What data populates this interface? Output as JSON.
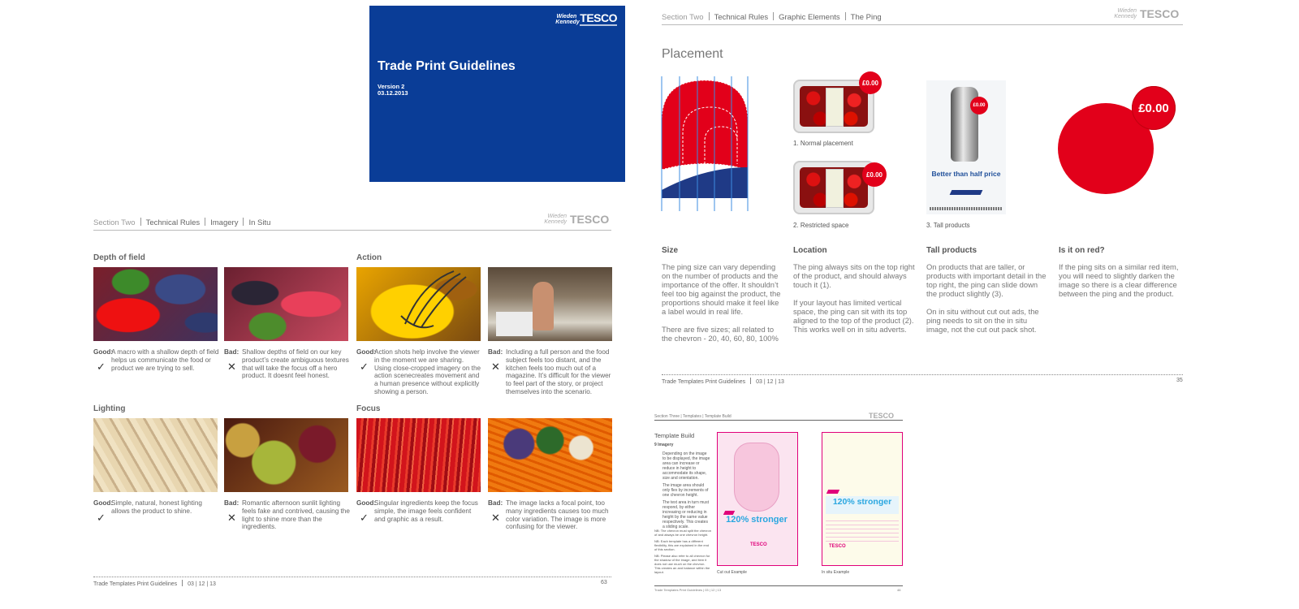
{
  "cover": {
    "logo_wk": "Wieden Kennedy",
    "logo_tesco": "TESCO",
    "title": "Trade Print Guidelines",
    "version": "Version 2",
    "date": "03.12.2013"
  },
  "imagery_page": {
    "breadcrumb": [
      "Section Two",
      "Technical Rules",
      "Imagery",
      "In Situ"
    ],
    "logo_wk": "Wieden Kennedy",
    "logo_tesco": "TESCO",
    "sections": {
      "depth": "Depth of field",
      "action": "Action",
      "lighting": "Lighting",
      "focus": "Focus"
    },
    "captions": [
      {
        "label": "Good:",
        "text": "A macro with a shallow depth of field helps us communicate the food or product we are trying to sell.",
        "mark": "✓"
      },
      {
        "label": "Bad:",
        "text": "Shallow depths of field on our key product’s create ambiguous textures that will take the focus off a hero product. It doesnt feel honest.",
        "mark": "✕"
      },
      {
        "label": "Good:",
        "text": "Action shots help involve the viewer in the moment we are sharing. Using close-cropped imagery on the action scenecreates movement and a human presence without explicitly showing a person.",
        "mark": "✓"
      },
      {
        "label": "Bad:",
        "text": "Including a full person and the food subject feels too distant, and the kitchen feels too much out of a magazine. It’s difficult for the viewer to feel part of the story, or project themselves into the scenario.",
        "mark": "✕"
      },
      {
        "label": "Good:",
        "text": "Simple, natural, honest lighting allows the product to shine.",
        "mark": "✓"
      },
      {
        "label": "Bad:",
        "text": "Romantic afternoon sunlit lighting feels fake and contrived, causing the light to shine more than the ingredients.",
        "mark": "✕"
      },
      {
        "label": "Good:",
        "text": "Singular ingredients keep the focus simple, the image feels confident and graphic as a result.",
        "mark": "✓"
      },
      {
        "label": "Bad:",
        "text": "The image lacks a focal point, too many ingredients causes too much color variation. The image is more confusing for the viewer.",
        "mark": "✕"
      }
    ],
    "footer_left": "Trade Templates Print Guidelines",
    "footer_date": "03 | 12 | 13",
    "footer_page": "63"
  },
  "ping_page": {
    "breadcrumb": [
      "Section Two",
      "Technical Rules",
      "Graphic Elements",
      "The Ping"
    ],
    "logo_wk": "Wieden Kennedy",
    "logo_tesco": "TESCO",
    "heading": "Placement",
    "price_small": "£0.00",
    "price_mid": "£0.00",
    "price_tall": "£0.00",
    "price_big": "£0.00",
    "caption_normal": "1. Normal placement",
    "caption_restricted": "2. Restricted space",
    "caption_tall": "3. Tall products",
    "tall_product_text": "Better than half price",
    "columns": [
      {
        "head": "Size",
        "paras": [
          "The ping size can vary depending on the number of products and the importance of the offer. It shouldn’t feel too big against the product, the proportions should make it feel like a label would in real life.",
          "There are five sizes; all related to the chevron - 20, 40, 60, 80, 100%"
        ]
      },
      {
        "head": "Location",
        "paras": [
          "The ping always sits on the top right of the product, and should always touch it (1).",
          "If your layout has limited vertical space, the ping can sit with its top aligned to the top of the product (2). This works well on in situ adverts."
        ]
      },
      {
        "head": "Tall products",
        "paras": [
          "On products that are taller, or products with important detail in the top right, the ping can slide down the product slightly (3).",
          "On in situ without cut out ads, the ping needs to sit on the in situ image, not the cut out pack shot."
        ]
      },
      {
        "head": "Is it on red?",
        "paras": [
          "If the ping sits on a similar red item, you will need to slightly darken the image so there is a clear difference between the ping and the product."
        ]
      }
    ],
    "footer_left": "Trade Templates Print Guidelines",
    "footer_date": "03 | 12 | 13",
    "footer_page": "35"
  },
  "template_page": {
    "breadcrumb": [
      "Section Three",
      "Templates",
      "Template Build"
    ],
    "heading": "Template Build",
    "subhead": "9   Imagery",
    "paras": [
      "Depending on the image to be displayed, the image area can increase or reduce in height to accommodate its shape, size and orientation.",
      "The image area should only flex by increments of one chevron height.",
      "The text area in turn must respond, by either increasing or reducing in height by the same value respectively. This creates a sliding scale."
    ],
    "notes": [
      "NB: The chevron must split the chevron of and always be one chevron height.",
      "NB: Each template has a different flexibility, this are explained in the end of this section.",
      "NB: Please also refer to all chevron for the shadow of the image, and item it does not use much on the chevron. This creates an and balance within the layout."
    ],
    "headline_text": "120% stronger",
    "caption_left": "Cut out Example",
    "caption_right": "In situ Example",
    "footer_left": "Trade Templates Print Guidelines",
    "footer_date": "03 | 12 | 13",
    "footer_page": "46"
  },
  "colors": {
    "tesco_blue": "#0a3d97",
    "tesco_red": "#e2001a",
    "template_pink": "#e0007a",
    "headline_blue": "#2aa7e0"
  }
}
